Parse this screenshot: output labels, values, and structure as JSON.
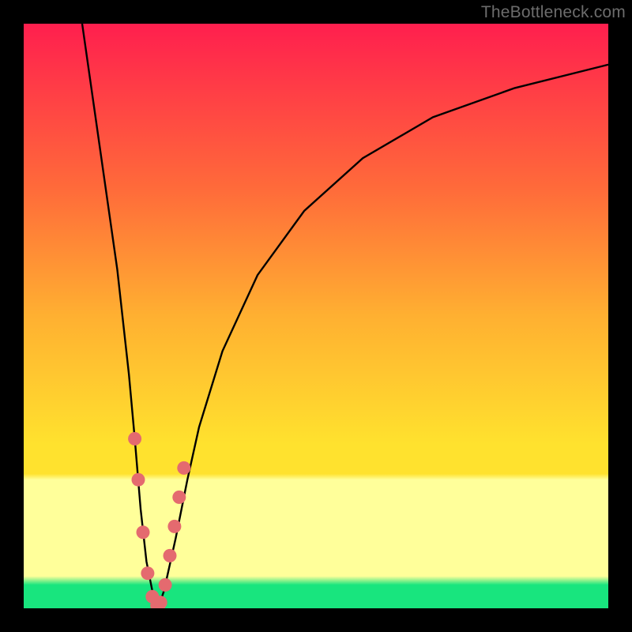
{
  "watermark": "TheBottleneck.com",
  "colors": {
    "top": "#ff1f4e",
    "mid1": "#ff6a3a",
    "mid2": "#ffb031",
    "mid3": "#ffe22e",
    "paleYellow": "#ffff9a",
    "green": "#18e57e",
    "curve": "#000000",
    "marker": "#e46a6f",
    "bg": "#000000"
  },
  "chart_data": {
    "type": "line",
    "title": "",
    "xlabel": "",
    "ylabel": "",
    "xlim": [
      0,
      100
    ],
    "ylim": [
      0,
      100
    ],
    "series": [
      {
        "name": "curve",
        "x": [
          10,
          12,
          14,
          16,
          18,
          19,
          20,
          21,
          22,
          23,
          24,
          26,
          28,
          30,
          34,
          40,
          48,
          58,
          70,
          84,
          100
        ],
        "values": [
          100,
          86,
          72,
          58,
          40,
          29,
          17,
          8,
          3,
          0,
          3,
          12,
          22,
          31,
          44,
          57,
          68,
          77,
          84,
          89,
          93
        ]
      }
    ],
    "markers": {
      "name": "highlighted-points",
      "x": [
        19.0,
        19.6,
        20.4,
        21.2,
        22.0,
        22.8,
        23.0,
        23.4,
        24.2,
        25.0,
        25.8,
        26.6,
        27.4
      ],
      "values": [
        29.0,
        22.0,
        13.0,
        6.0,
        2.0,
        0.5,
        0.0,
        1.0,
        4.0,
        9.0,
        14.0,
        19.0,
        24.0
      ]
    }
  }
}
